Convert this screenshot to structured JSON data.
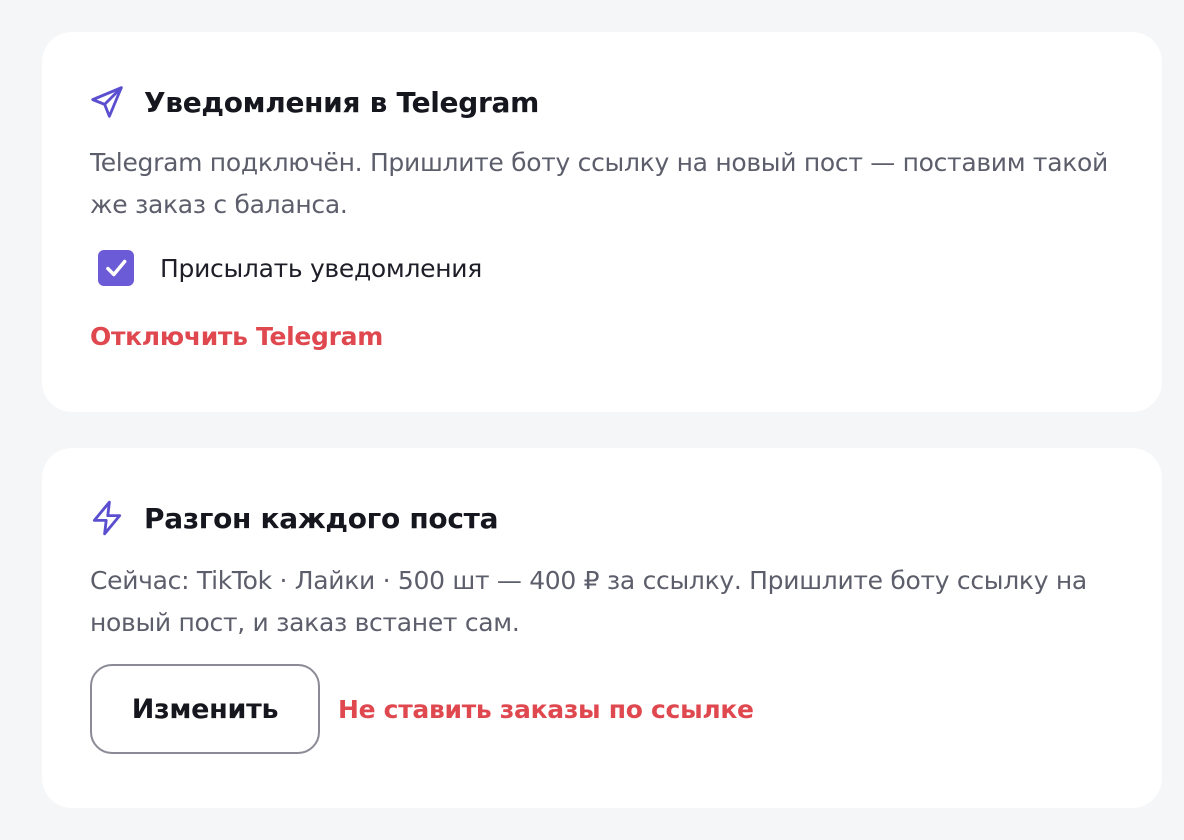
{
  "telegram_card": {
    "icon": "send-icon",
    "title": "Уведомления в Telegram",
    "description": "Telegram подключён. Пришлите боту ссылку на новый пост — поставим такой же заказ с баланса.",
    "notifications_checkbox": {
      "label": "Присылать уведомления",
      "checked": true
    },
    "disconnect_label": "Отключить Telegram"
  },
  "boost_card": {
    "icon": "lightning-icon",
    "title": "Разгон каждого поста",
    "description": "Сейчас: TikTok · Лайки · 500 шт — 400 ₽ за ссылку. Пришлите боту ссылку на новый пост, и заказ встанет сам.",
    "change_label": "Изменить",
    "stop_label": "Не ставить заказы по ссылке"
  },
  "colors": {
    "accent": "#6b5bd6",
    "danger": "#e0484f",
    "background": "#f5f6f8",
    "card": "#ffffff"
  }
}
